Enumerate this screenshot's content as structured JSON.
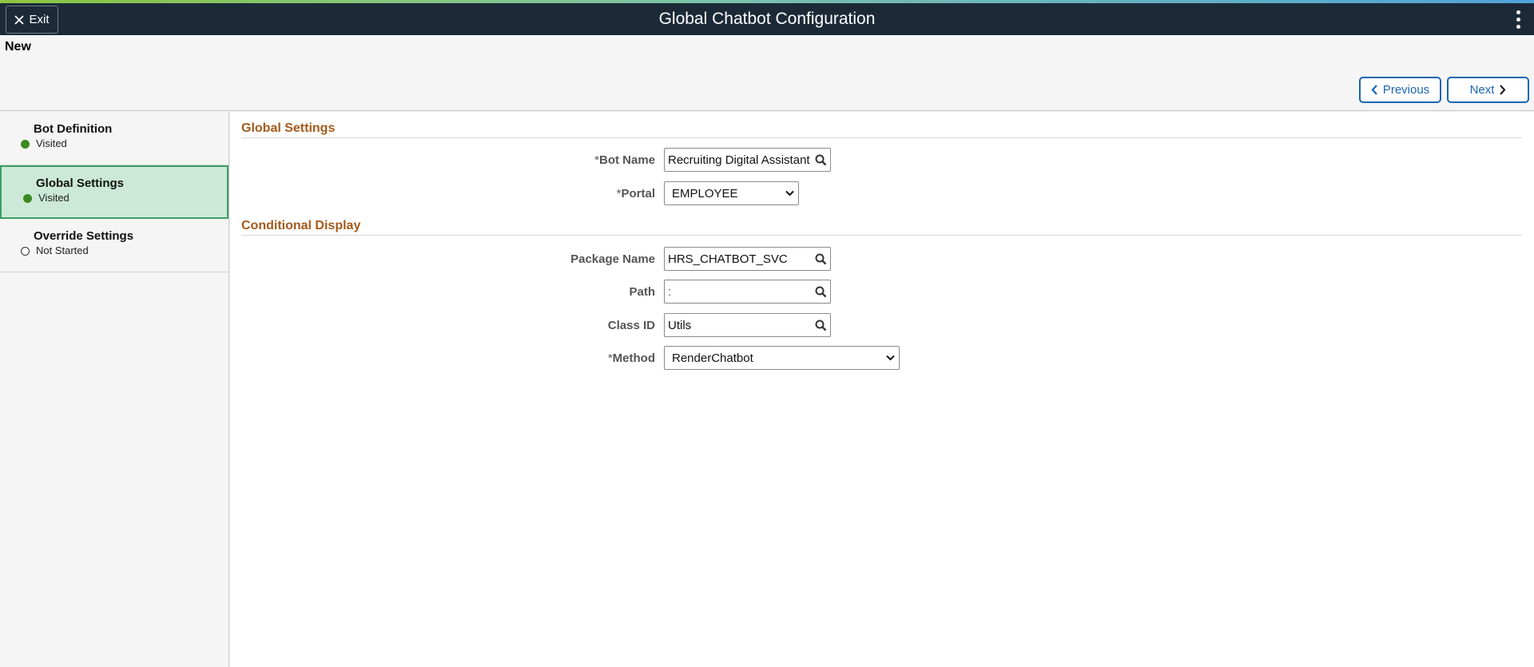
{
  "banner": {
    "exit_label": "Exit",
    "title": "Global Chatbot Configuration"
  },
  "page": {
    "label": "New",
    "previous_label": "Previous",
    "next_label": "Next"
  },
  "steps": [
    {
      "label": "Bot Definition",
      "status": "Visited"
    },
    {
      "label": "Global Settings",
      "status": "Visited"
    },
    {
      "label": "Override Settings",
      "status": "Not Started"
    }
  ],
  "global_settings": {
    "title": "Global Settings",
    "bot_name_label": "Bot Name",
    "bot_name_value": "Recruiting Digital Assistant",
    "portal_label": "Portal",
    "portal_value": "EMPLOYEE"
  },
  "conditional_display": {
    "title": "Conditional Display",
    "package_label": "Package Name",
    "package_value": "HRS_CHATBOT_SVC",
    "path_label": "Path",
    "path_value": ":",
    "class_label": "Class ID",
    "class_value": "Utils",
    "method_label": "Method",
    "method_value": "RenderChatbot"
  },
  "required_marker": "*",
  "colors": {
    "banner": "#1c2a38",
    "active_step": "#cce9d8",
    "section_title": "#a35a1b",
    "button_accent": "#1a66b3",
    "visited_dot": "#3b8a21"
  }
}
